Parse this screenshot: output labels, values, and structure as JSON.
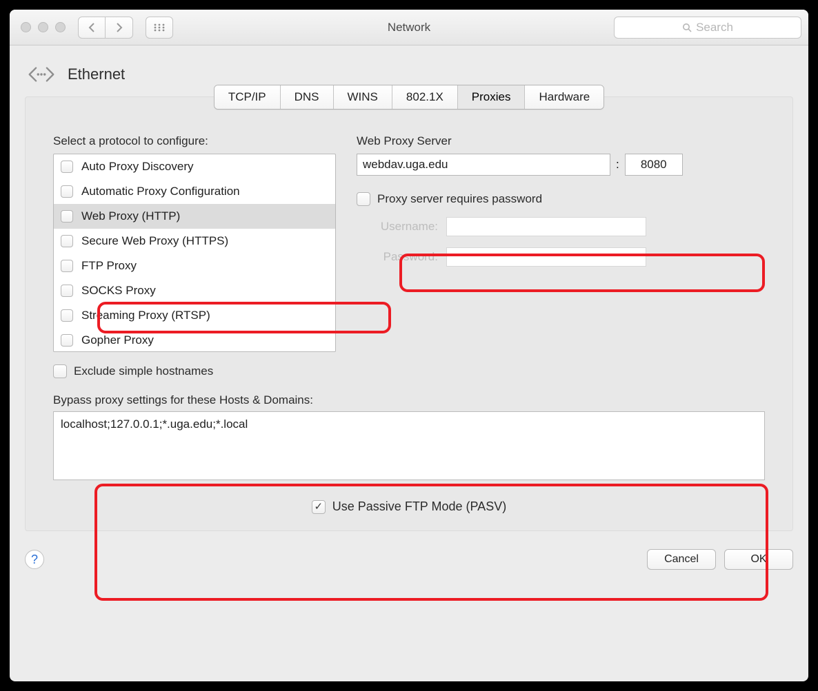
{
  "window": {
    "title": "Network",
    "search_placeholder": "Search"
  },
  "interface": {
    "name": "Ethernet"
  },
  "tabs": [
    "TCP/IP",
    "DNS",
    "WINS",
    "802.1X",
    "Proxies",
    "Hardware"
  ],
  "active_tab": "Proxies",
  "protocols": {
    "label": "Select a protocol to configure:",
    "items": [
      {
        "label": "Auto Proxy Discovery",
        "checked": false,
        "selected": false
      },
      {
        "label": "Automatic Proxy Configuration",
        "checked": false,
        "selected": false
      },
      {
        "label": "Web Proxy (HTTP)",
        "checked": false,
        "selected": true
      },
      {
        "label": "Secure Web Proxy (HTTPS)",
        "checked": false,
        "selected": false
      },
      {
        "label": "FTP Proxy",
        "checked": false,
        "selected": false
      },
      {
        "label": "SOCKS Proxy",
        "checked": false,
        "selected": false
      },
      {
        "label": "Streaming Proxy (RTSP)",
        "checked": false,
        "selected": false
      },
      {
        "label": "Gopher Proxy",
        "checked": false,
        "selected": false
      }
    ]
  },
  "server": {
    "label": "Web Proxy Server",
    "host": "webdav.uga.edu",
    "separator": ":",
    "port": "8080",
    "requires_password_label": "Proxy server requires password",
    "requires_password_checked": false,
    "username_label": "Username:",
    "password_label": "Password:",
    "username_value": "",
    "password_value": ""
  },
  "exclude": {
    "label": "Exclude simple hostnames",
    "checked": false
  },
  "bypass": {
    "label": "Bypass proxy settings for these Hosts & Domains:",
    "value": "localhost;127.0.0.1;*.uga.edu;*.local"
  },
  "pasv": {
    "label": "Use Passive FTP Mode (PASV)",
    "checked": true
  },
  "footer": {
    "cancel": "Cancel",
    "ok": "OK"
  }
}
